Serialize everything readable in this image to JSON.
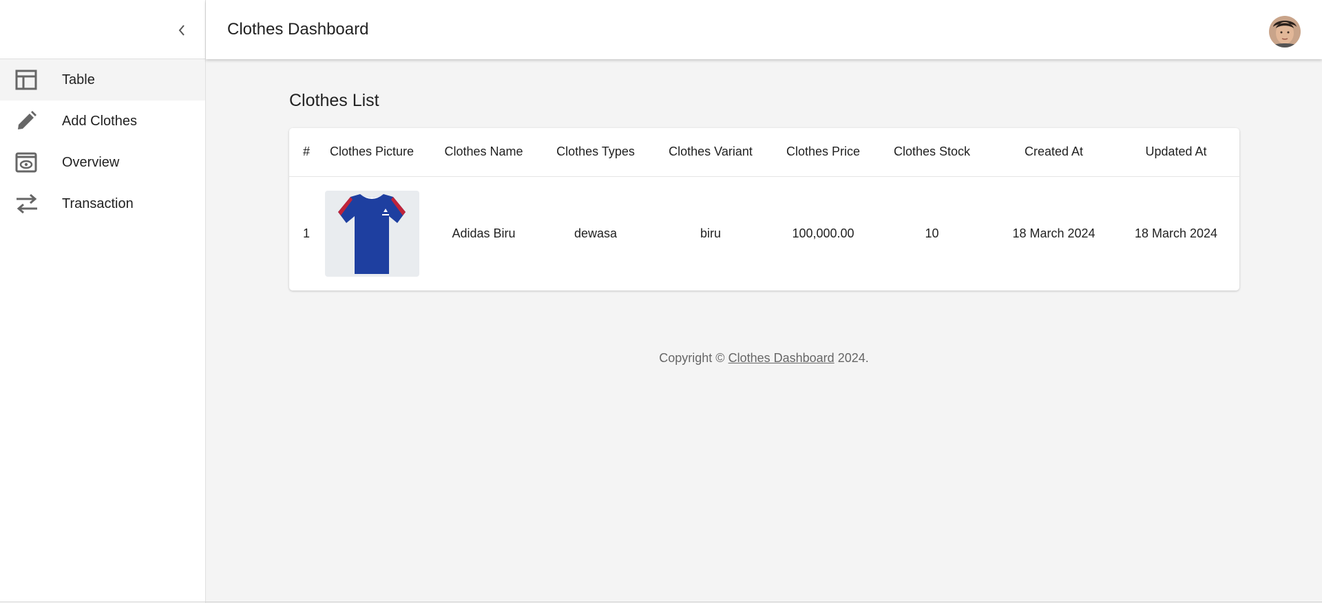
{
  "header": {
    "title": "Clothes Dashboard"
  },
  "sidebar": {
    "items": [
      {
        "label": "Table",
        "icon": "table-icon",
        "active": true
      },
      {
        "label": "Add Clothes",
        "icon": "pencil-icon",
        "active": false
      },
      {
        "label": "Overview",
        "icon": "preview-icon",
        "active": false
      },
      {
        "label": "Transaction",
        "icon": "swap-icon",
        "active": false
      }
    ]
  },
  "main": {
    "title": "Clothes List",
    "table": {
      "headers": [
        "#",
        "Clothes Picture",
        "Clothes Name",
        "Clothes Types",
        "Clothes Variant",
        "Clothes Price",
        "Clothes Stock",
        "Created At",
        "Updated At"
      ],
      "rows": [
        {
          "no": "1",
          "name": "Adidas Biru",
          "type": "dewasa",
          "variant": "biru",
          "price": "100,000.00",
          "stock": "10",
          "created": "18 March 2024",
          "updated": "18 March 2024"
        }
      ]
    }
  },
  "footer": {
    "prefix": "Copyright ©",
    "link": "Clothes Dashboard",
    "suffix": "2024."
  },
  "colors": {
    "shirt": "#1e3fa0",
    "stripe": "#c0243a",
    "icon": "#666666"
  }
}
